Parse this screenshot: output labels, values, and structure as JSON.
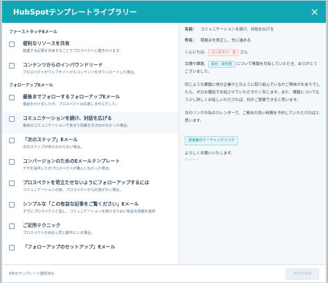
{
  "modal": {
    "title": "HubSpotテンプレートライブラリー",
    "close_icon": "×"
  },
  "sections": [
    {
      "label": "ファーストタッチEメール",
      "items": [
        {
          "title": "便利なリソースを共有",
          "desc": "関連する記事を共有することでプロスペクトに働きかけます。"
        },
        {
          "title": "コンテンツからのインバウンドリード",
          "desc": "プロスペクトがウェブサイトからコンテンツをダウンロードした場合。"
        }
      ]
    },
    {
      "label": "フォローアップEメール",
      "items": [
        {
          "title": "最後までフォローするフォローアップEメール",
          "desc": "電話をかけましたが、プロスペクトは応答しませんでした。"
        },
        {
          "title": "コミュニケーションを続け、対話を広げる",
          "desc": "最初のコミュニケーションであまり情報を引き出せなかった場合。"
        },
        {
          "title": "「次のステップ」Eメール",
          "desc": "次のステップが何かわからない場合。"
        },
        {
          "title": "コンバージョンのためのEメールテンプレート",
          "desc": "デモを提供したがプロスペクトが購入しなかった場合。"
        },
        {
          "title": "プロスペクトを苛立たせないようにフォローアップするには",
          "desc": "コミュニケーションの後、プロスペクトから応答がない場合。"
        },
        {
          "title": "シンプルな「この有益な記事をご覧ください」Eメール",
          "desc": "すでにプロスペクトと話し、コミュニケーションを続けるために有益な情報を提供"
        },
        {
          "title": "ご近所テクニック",
          "desc": "プロスペクトの会社と同じ都市にいる場合。"
        },
        {
          "title": "「フォローアップのセットアップ」Eメール",
          "desc": ""
        }
      ]
    }
  ],
  "preview": {
    "name_label": "名前：",
    "name_value": "コミュニケーションを続け、対話を広げる",
    "subject_label": "件名：",
    "subject_value": "問題点を修正し、先に進める",
    "greeting_prefix": "こんにちは、",
    "contact_token": "コンタクト：名",
    "greeting_suffix": "さん",
    "p1_prefix": "目標や課題、",
    "company_token": "会社：会社名",
    "p1_suffix": "について情報を共有していただき、ありがとうございました。",
    "p2": "同じような課題に他の企業がどのように取り組んでいるかご興味がおありでしたら、ぜひお電話でお話させていただきたく存じます。また、課題についてもう少し詳しくお話しいただければ、何かご提案できると思います。",
    "p3": "次のリンクの私のカレンダーで、ご都合の良い時間を予約していただければと思います。",
    "meeting_token": "送信者のミーティングリンク",
    "closing": "よろしくお願いいたします。",
    "sender_name": "Ryutaro"
  },
  "footer": {
    "count_text": "0件のテンプレート選択済み",
    "save_label": "選択を保存"
  }
}
